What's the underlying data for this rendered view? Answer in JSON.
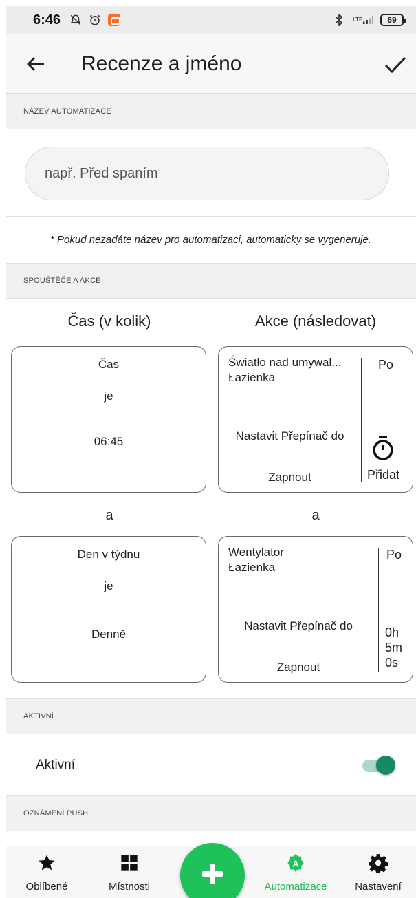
{
  "status": {
    "time": "6:46",
    "battery": "69",
    "network": "LTE"
  },
  "appbar": {
    "title": "Recenze a jméno"
  },
  "sections": {
    "name": "NÁZEV AUTOMATIZACE",
    "triggers": "SPOUŠTĚČE A AKCE",
    "active": "AKTIVNÍ",
    "push": "OZNÁMENÍ PUSH"
  },
  "name_input": {
    "placeholder": "např. Před spaním"
  },
  "hint": "* Pokud nezadáte název pro automatizaci, automaticky se vygeneruje.",
  "columns": {
    "when": "Čas (v kolik)",
    "then": "Akce (následovat)"
  },
  "conditions": [
    {
      "title": "Čas",
      "op": "je",
      "value": "06:45"
    },
    {
      "title": "Den v týdnu",
      "op": "je",
      "value": "Denně"
    }
  ],
  "actions": [
    {
      "device": "Światło nad umywal...",
      "room": "Łazienka",
      "command": "Nastavit Přepínač do",
      "state": "Zapnout",
      "side_top": "Po",
      "side_bottom": "Přidat"
    },
    {
      "device": "Wentylator",
      "room": "Łazienka",
      "command": "Nastavit Přepínač do",
      "state": "Zapnout",
      "side_top": "Po",
      "delay_h": "0h",
      "delay_m": "5m",
      "delay_s": "0s"
    }
  ],
  "connector": "a",
  "active": {
    "label": "Aktivní",
    "on": true
  },
  "nav": [
    {
      "label": "Oblíbené",
      "icon": "star-icon"
    },
    {
      "label": "Místnosti",
      "icon": "grid-icon"
    },
    {
      "label": "Automatizace",
      "icon": "automation-icon",
      "active": true
    },
    {
      "label": "Nastavení",
      "icon": "gear-icon"
    }
  ],
  "colors": {
    "accent": "#1FC15A",
    "toggle": "#168A64"
  }
}
